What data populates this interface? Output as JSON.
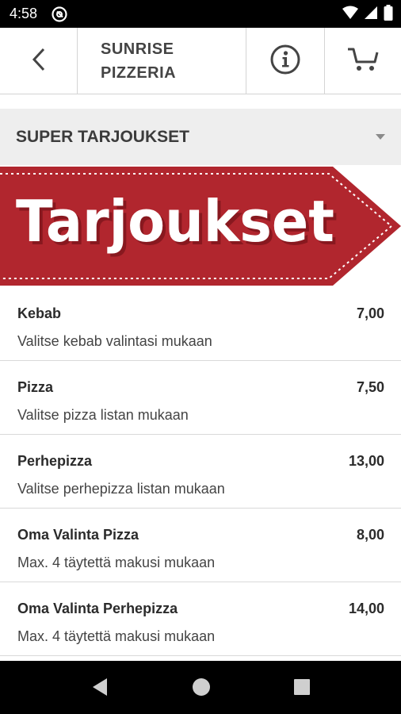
{
  "status_bar": {
    "time": "4:58",
    "icons": [
      "do-not-disturb-icon",
      "wifi-icon",
      "signal-icon",
      "battery-icon"
    ]
  },
  "top_bar": {
    "title": "SUNRISE\nPIZZERIA",
    "icons": [
      "back-arrow-icon",
      "info-icon",
      "cart-icon"
    ]
  },
  "category": {
    "title": "SUPER TARJOUKSET",
    "icon": "dropdown-caret-icon"
  },
  "banner": {
    "text": "Tarjoukset",
    "color": "#b1262e"
  },
  "menu": {
    "items": [
      {
        "name": "Kebab",
        "price": "7,00",
        "description": "Valitse kebab valintasi mukaan"
      },
      {
        "name": "Pizza",
        "price": "7,50",
        "description": "Valitse pizza listan mukaan"
      },
      {
        "name": "Perhepizza",
        "price": "13,00",
        "description": "Valitse perhepizza listan mukaan"
      },
      {
        "name": "Oma Valinta Pizza",
        "price": "8,00",
        "description": "Max. 4 täytettä makusi mukaan"
      },
      {
        "name": "Oma Valinta Perhepizza",
        "price": "14,00",
        "description": "Max. 4 täytettä makusi mukaan"
      }
    ]
  },
  "nav_bar": {
    "icons": [
      "back-triangle-icon",
      "home-circle-icon",
      "recents-square-icon"
    ]
  },
  "colors": {
    "status_bar": "#000000",
    "banner_red": "#b1262e",
    "category_bg": "#eeeeee"
  }
}
